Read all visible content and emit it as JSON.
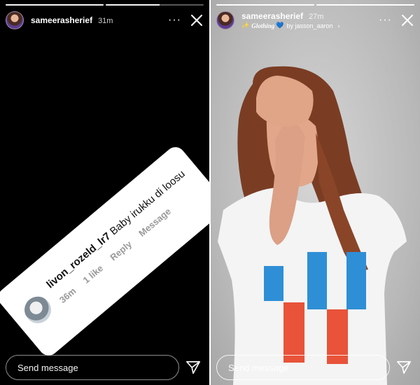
{
  "stories": [
    {
      "username": "sameerasherief",
      "time": "31m",
      "progress": [
        1,
        0.55
      ],
      "comment": {
        "user": "livon_rozeld_lr7",
        "text": "Baby irukku di loosu",
        "age": "36m",
        "likes": "1 like",
        "reply_label": "Reply",
        "message_label": "Message"
      },
      "footer": {
        "placeholder": "Send message"
      }
    },
    {
      "username": "sameerasherief",
      "time": "27m",
      "music": {
        "sparkle": "✨",
        "title": "Glothing",
        "heart": "💙",
        "by": "by jasson_aaron",
        "chevron": "›"
      },
      "progress": [
        1,
        1
      ],
      "footer": {
        "placeholder": "Send message"
      }
    }
  ],
  "icons": {
    "more": "···",
    "close": "close-icon",
    "send": "paper-plane-icon"
  },
  "colors": {
    "story_bg": "#000000",
    "text": "#ffffff",
    "muted_meta": "#999999",
    "heart": "#3c8cf0",
    "shirt_blue": "#2f8fd6",
    "shirt_red": "#e8533a"
  }
}
